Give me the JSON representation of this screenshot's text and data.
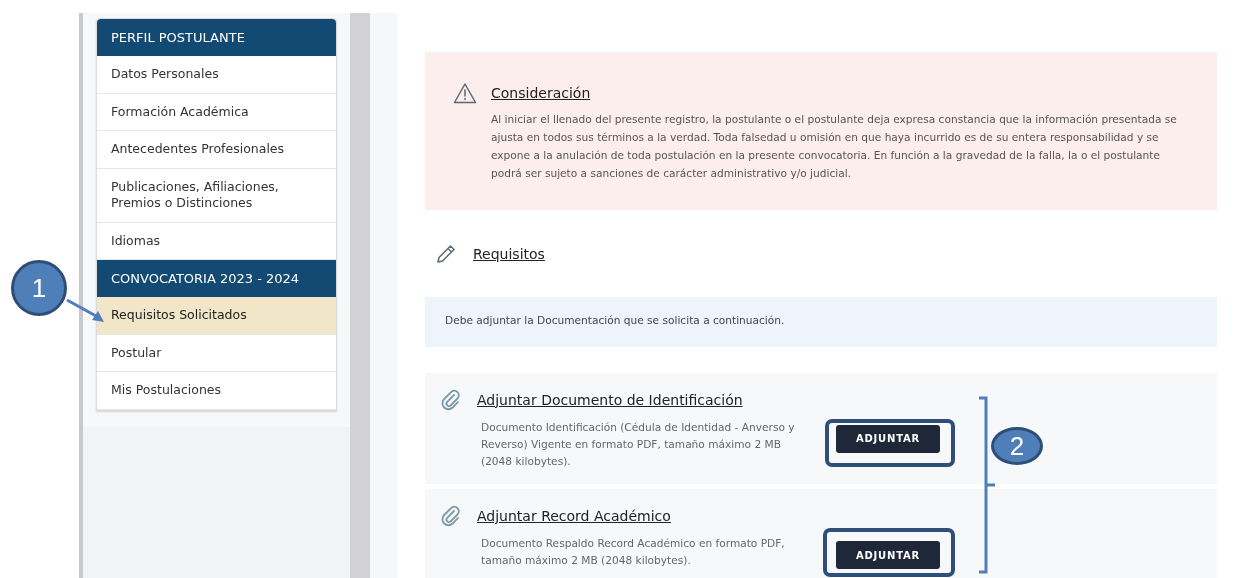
{
  "sidebar": {
    "items": [
      {
        "kind": "header",
        "label": "PERFIL POSTULANTE"
      },
      {
        "kind": "item",
        "label": "Datos Personales",
        "selected": false
      },
      {
        "kind": "item",
        "label": "Formación Académica",
        "selected": false
      },
      {
        "kind": "item",
        "label": "Antecedentes Profesionales",
        "selected": false
      },
      {
        "kind": "item",
        "label": "Publicaciones, Afiliaciones, Premios o Distinciones",
        "selected": false
      },
      {
        "kind": "item",
        "label": "Idiomas",
        "selected": false
      },
      {
        "kind": "header",
        "label": "CONVOCATORIA 2023 - 2024"
      },
      {
        "kind": "item",
        "label": "Requisitos Solicitados",
        "selected": true
      },
      {
        "kind": "item",
        "label": "Postular",
        "selected": false
      },
      {
        "kind": "item",
        "label": "Mis Postulaciones",
        "selected": false
      }
    ]
  },
  "notice": {
    "title": "Consideración",
    "text": "Al iniciar el llenado del presente registro, la postulante o el postulante deja expresa constancia que la información presentada se ajusta en todos sus términos a la verdad. Toda falsedad u omisión en que haya incurrido es de su entera responsabilidad y se expone a la anulación de toda postulación en la presente convocatoria. En función a la gravedad de la falla, la o el postulante podrá ser sujeto a sanciones de carácter administrativo y/o judicial."
  },
  "requirements": {
    "title": "Requisitos",
    "info": "Debe adjuntar la Documentación que se solicita a continuación.",
    "attachments": [
      {
        "title": "Adjuntar Documento de Identificación",
        "description": "Documento Identificación (Cédula de Identidad - Anverso y Reverso) Vigente en formato PDF, tamaño máximo 2 MB (2048 kilobytes).",
        "button": "ADJUNTAR"
      },
      {
        "title": "Adjuntar Record Académico",
        "description": "Documento Respaldo Record Académico en formato PDF, tamaño máximo 2 MB (2048 kilobytes).",
        "button": "ADJUNTAR"
      }
    ]
  },
  "annotations": [
    "1",
    "2"
  ]
}
